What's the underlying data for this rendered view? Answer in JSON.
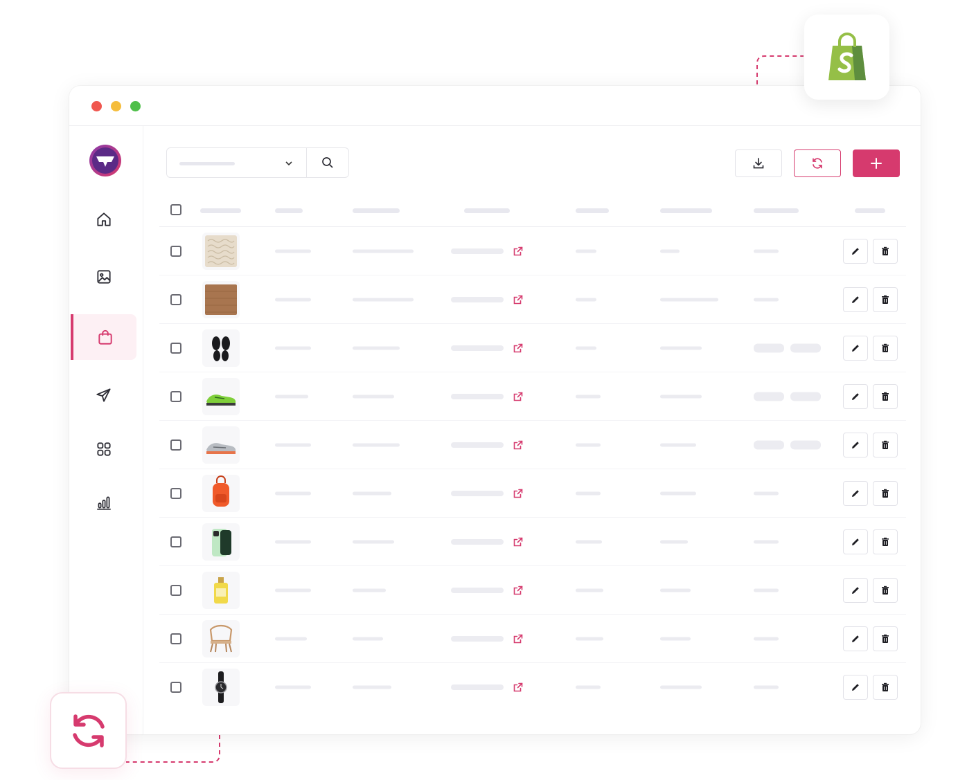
{
  "window": {
    "controls": [
      "close",
      "minimize",
      "maximize"
    ],
    "colors": {
      "close": "#f0574f",
      "minimize": "#f5bd3c",
      "maximize": "#4fbf4a"
    }
  },
  "brand": {
    "accent": "#d63a6e",
    "logo_ring": "#7a3aa6"
  },
  "sidebar": {
    "items": [
      {
        "icon": "home-icon",
        "active": false
      },
      {
        "icon": "image-icon",
        "active": false
      },
      {
        "icon": "shopping-bag-icon",
        "active": true
      },
      {
        "icon": "send-icon",
        "active": false
      },
      {
        "icon": "grid-icon",
        "active": false
      },
      {
        "icon": "bar-chart-icon",
        "active": false
      }
    ]
  },
  "toolbar": {
    "buttons": [
      "download-icon",
      "sync-icon",
      "plus-icon"
    ]
  },
  "table": {
    "rows": [
      {
        "product": "textured-fabric-swatch",
        "has_pills": false
      },
      {
        "product": "brown-fabric-swatch",
        "has_pills": false
      },
      {
        "product": "black-insoles",
        "has_pills": true
      },
      {
        "product": "green-sneaker",
        "has_pills": true
      },
      {
        "product": "grey-sneaker",
        "has_pills": true
      },
      {
        "product": "orange-backpack",
        "has_pills": false
      },
      {
        "product": "green-phone",
        "has_pills": false
      },
      {
        "product": "perfume-bottle",
        "has_pills": false
      },
      {
        "product": "rattan-chair",
        "has_pills": false
      },
      {
        "product": "black-watch",
        "has_pills": false
      }
    ]
  },
  "integrations": {
    "top_right": "shopify-bag-icon",
    "bottom_left": "sync-icon"
  }
}
